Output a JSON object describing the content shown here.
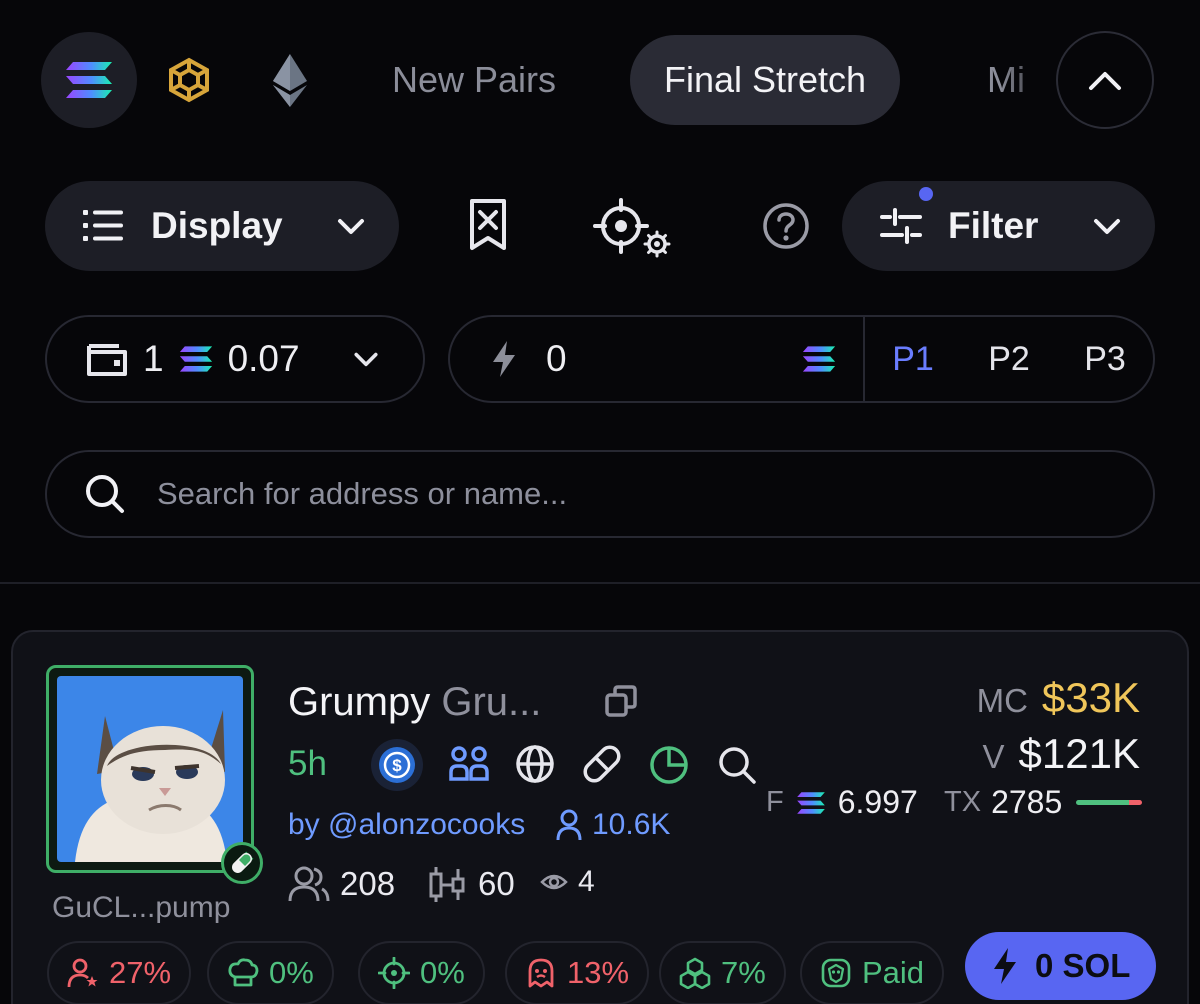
{
  "colors": {
    "bg": "#060609",
    "accent": "#5866f2",
    "green": "#4fc07f",
    "red": "#f0626a",
    "gold": "#f0c65a",
    "link": "#6f9bff"
  },
  "chains": [
    {
      "icon": "solana-icon",
      "active": true
    },
    {
      "icon": "bnb-icon",
      "active": false
    },
    {
      "icon": "ethereum-icon",
      "active": false
    }
  ],
  "tabs": [
    {
      "label": "New Pairs",
      "active": false
    },
    {
      "label": "Final Stretch",
      "active": true
    },
    {
      "label": "Mi",
      "active": false
    }
  ],
  "toolbar": {
    "display_label": "Display",
    "filter_label": "Filter",
    "filter_active_dot": true
  },
  "quick_buy": {
    "wallet_count": "1",
    "amount": "0.07",
    "buy_value": "0",
    "presets": [
      "P1",
      "P2",
      "P3"
    ],
    "active_preset": "P1"
  },
  "search": {
    "placeholder": "Search for address or name..."
  },
  "token": {
    "name": "Grumpy",
    "ticker": "Gru...",
    "address": "GuCL...pump",
    "age": "5h",
    "creator": "by @alonzocooks",
    "followers": "10.6K",
    "holders": "208",
    "candles": "60",
    "watchers": "4",
    "mc_label": "MC",
    "mc": "$33K",
    "v_label": "V",
    "volume": "$121K",
    "f_label": "F",
    "fees": "6.997",
    "tx_label": "TX",
    "tx": "2785",
    "buy_sell_ratio": 0.8,
    "chips": [
      {
        "icon": "top-holders-icon",
        "value": "27%",
        "tone": "red"
      },
      {
        "icon": "dev-hat-icon",
        "value": "0%",
        "tone": "green"
      },
      {
        "icon": "sniper-icon",
        "value": "0%",
        "tone": "green"
      },
      {
        "icon": "ghost-icon",
        "value": "13%",
        "tone": "red"
      },
      {
        "icon": "bundle-icon",
        "value": "7%",
        "tone": "green"
      },
      {
        "icon": "dex-paid-icon",
        "value": "Paid",
        "tone": "green"
      }
    ],
    "buy_label": "0 SOL"
  }
}
